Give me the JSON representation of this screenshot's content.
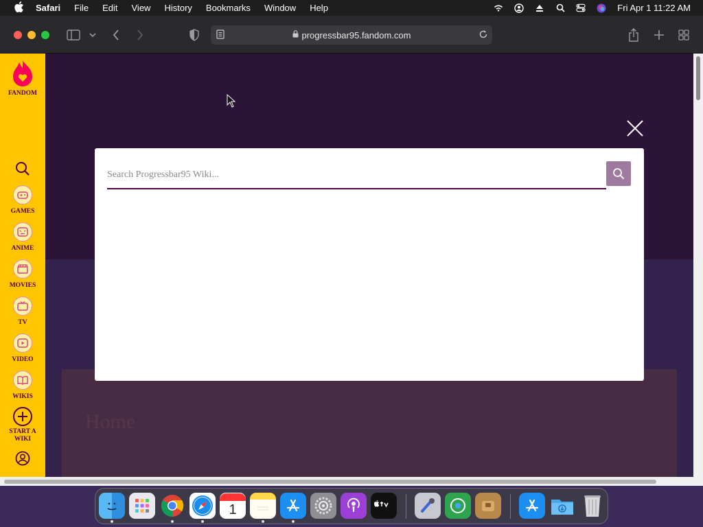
{
  "menubar": {
    "app_name": "Safari",
    "items": [
      "File",
      "Edit",
      "View",
      "History",
      "Bookmarks",
      "Window",
      "Help"
    ],
    "clock": "Fri Apr 1  11:22 AM"
  },
  "browser": {
    "url": "progressbar95.fandom.com"
  },
  "sidebar": {
    "logo_label": "FANDOM",
    "items": [
      {
        "label": "GAMES",
        "icon": "gamepad-icon"
      },
      {
        "label": "ANIME",
        "icon": "anime-icon"
      },
      {
        "label": "MOVIES",
        "icon": "clapperboard-icon"
      },
      {
        "label": "TV",
        "icon": "tv-icon"
      },
      {
        "label": "VIDEO",
        "icon": "play-icon"
      },
      {
        "label": "WIKIS",
        "icon": "book-icon"
      }
    ],
    "start_wiki_line1": "START A",
    "start_wiki_line2": "WIKI"
  },
  "search_modal": {
    "placeholder": "Search Progressbar95 Wiki...",
    "value": ""
  },
  "background_page": {
    "title": "Home"
  },
  "colors": {
    "fandom_yellow": "#ffc500",
    "fandom_purple": "#520044",
    "search_button": "#a07a9e"
  }
}
